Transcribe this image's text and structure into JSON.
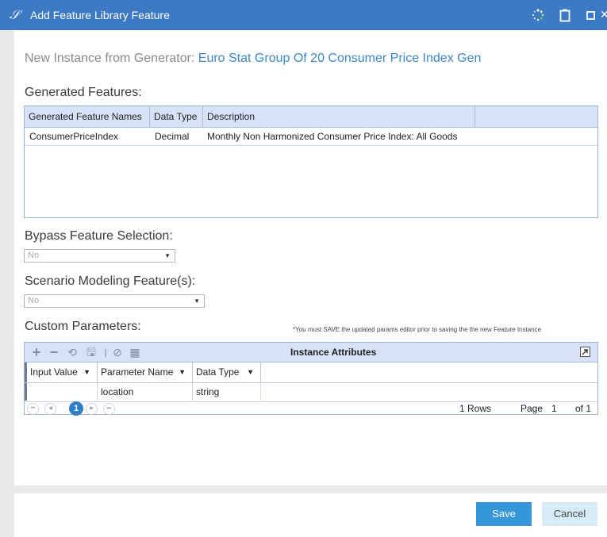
{
  "window": {
    "logo_glyph": "𝒮",
    "title": "Add Feature Library Feature",
    "icons": [
      "spinner-icon",
      "clipboard-icon",
      "restore-icon"
    ]
  },
  "generator": {
    "prefix": "New Instance from Generator:",
    "name": "Euro Stat Group Of 20 Consumer Price Index Gen"
  },
  "generated_features": {
    "heading": "Generated Features:",
    "columns": [
      "Generated Feature Names",
      "Data Type",
      "Description"
    ],
    "rows": [
      {
        "name": "ConsumerPriceIndex",
        "data_type": "Decimal",
        "description": "Monthly Non Harmonized Consumer Price Index: All Goods"
      }
    ]
  },
  "bypass": {
    "heading": "Bypass Feature Selection:",
    "value": "No"
  },
  "scenario": {
    "heading": "Scenario Modeling Feature(s):",
    "value": "No"
  },
  "custom_params": {
    "heading": "Custom Parameters:",
    "note": "*You must SAVE the updated params editor prior to saving the the new Feature Instance",
    "toolbar_title": "Instance Attributes",
    "columns": [
      "Input Value",
      "Parameter Name",
      "Data Type"
    ],
    "rows": [
      {
        "input_value": "",
        "parameter_name": "location",
        "data_type": "string"
      }
    ],
    "pager": {
      "current_page": "1",
      "rows_text": "1 Rows",
      "page_label": "Page",
      "page_value": "1",
      "of_text": "of 1"
    }
  },
  "footer": {
    "save_label": "Save",
    "cancel_label": "Cancel"
  },
  "colors": {
    "titlebar": "#3d7ac4",
    "accent": "#3596d9",
    "grid_header": "#d7e2f6"
  }
}
